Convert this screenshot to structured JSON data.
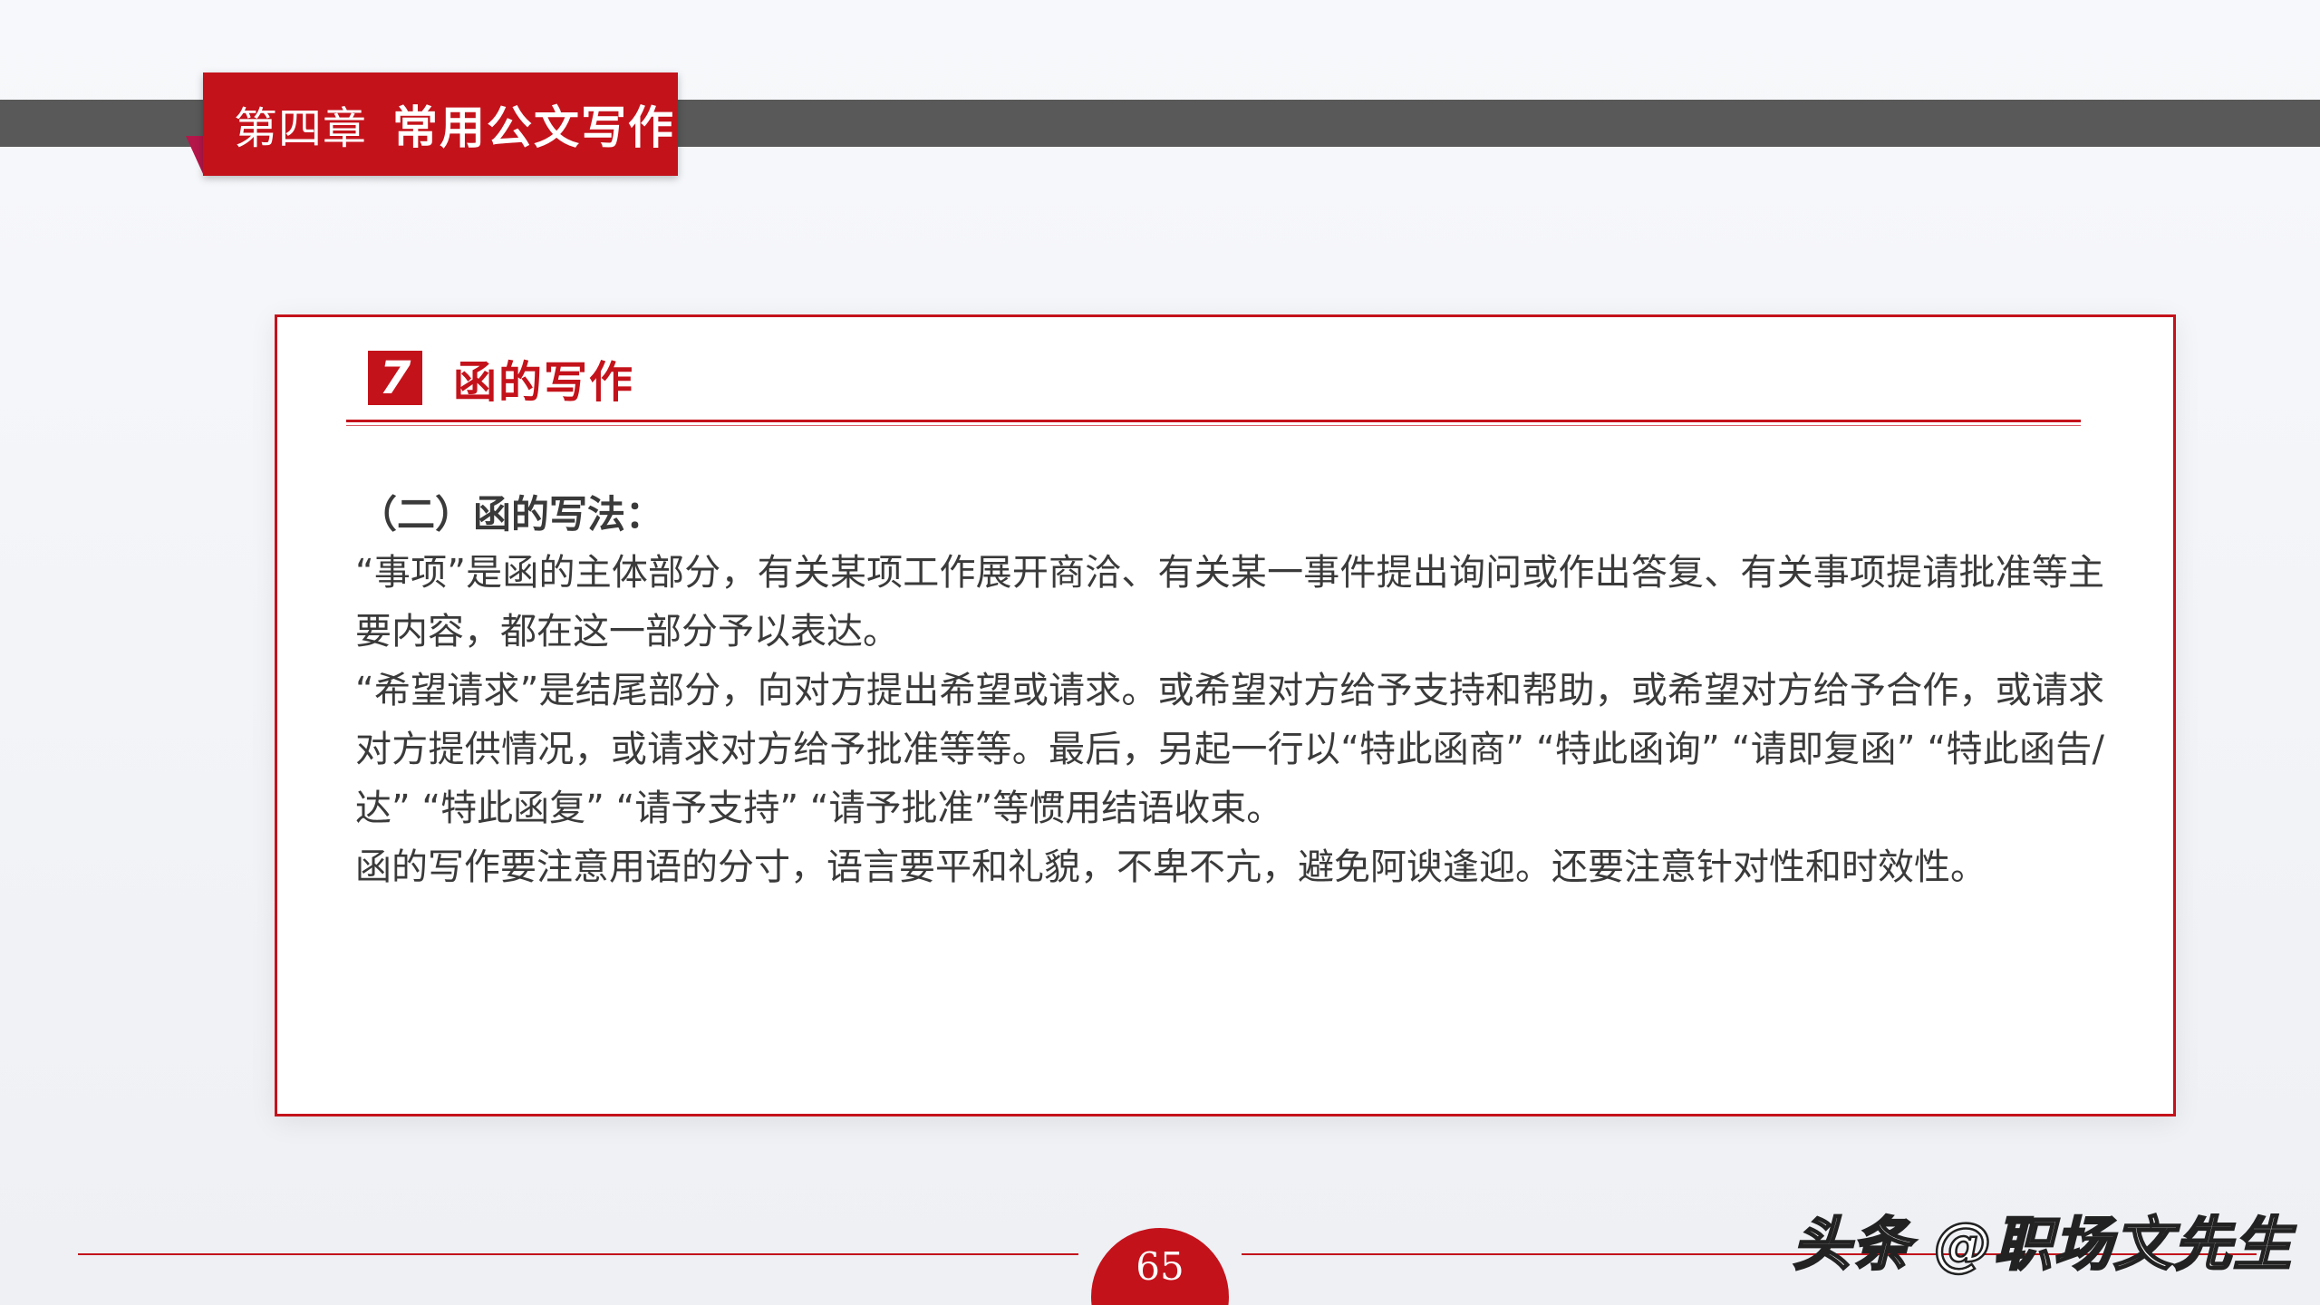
{
  "header": {
    "chapter_number": "第四章",
    "chapter_title": "常用公文写作"
  },
  "section": {
    "badge": "7",
    "title": "函的写作"
  },
  "content": {
    "subheading": "（二）函的写法：",
    "paragraphs": [
      "“事项”是函的主体部分，有关某项工作展开商洽、有关某一事件提出询问或作出答复、有关事项提请批准等主要内容，都在这一部分予以表达。",
      "“希望请求”是结尾部分，向对方提出希望或请求。或希望对方给予支持和帮助，或希望对方给予合作，或请求对方提供情况，或请求对方给予批准等等。最后，另起一行以“特此函商” “特此函询” “请即复函” “特此函告/达” “特此函复” “请予支持” “请予批准”等惯用结语收束。",
      "函的写作要注意用语的分寸，语言要平和礼貌，不卑不亢，避免阿谀逢迎。还要注意针对性和时效性。"
    ]
  },
  "footer": {
    "page_number": "65",
    "watermark": "头条 @职场文先生"
  },
  "colors": {
    "accent": "#c4121b",
    "bar": "#595959",
    "text": "#3a3a3a"
  }
}
